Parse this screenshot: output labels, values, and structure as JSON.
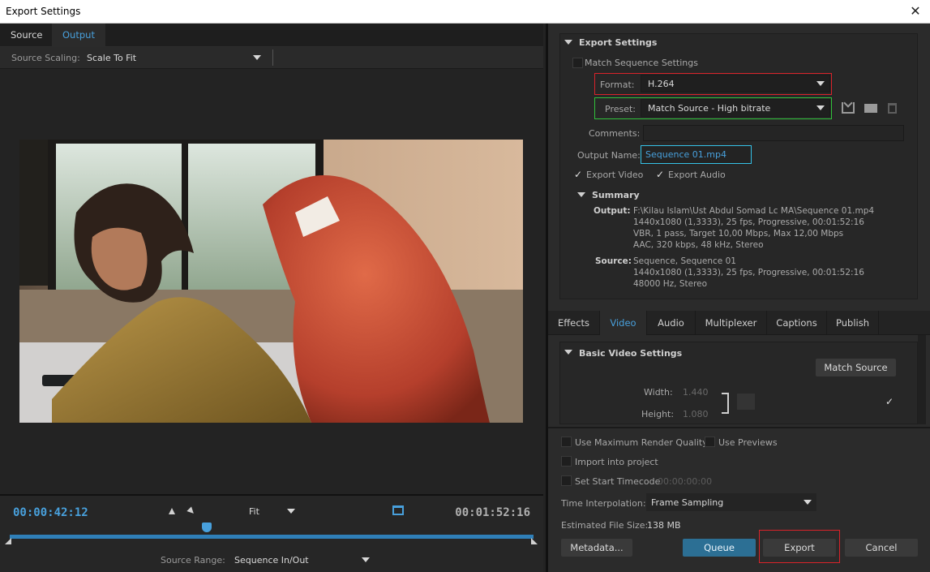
{
  "window": {
    "title": "Export Settings",
    "close_glyph": "✕"
  },
  "left": {
    "tabs": [
      {
        "label": "Source"
      },
      {
        "label": "Output"
      }
    ],
    "source_scaling": {
      "label": "Source Scaling:",
      "value": "Scale To Fit"
    },
    "timeline": {
      "current_time": "00:00:42:12",
      "duration": "00:01:52:16",
      "zoom": "Fit",
      "playhead_fraction": 0.376,
      "source_range": {
        "label": "Source Range:",
        "value": "Sequence In/Out"
      }
    }
  },
  "export_settings": {
    "header": "Export Settings",
    "match_sequence": {
      "label": "Match Sequence Settings",
      "checked": false
    },
    "format": {
      "label": "Format:",
      "value": "H.264"
    },
    "preset": {
      "label": "Preset:",
      "value": "Match Source - High bitrate"
    },
    "comments": {
      "label": "Comments:",
      "value": ""
    },
    "output_name": {
      "label": "Output Name:",
      "value": "Sequence 01.mp4"
    },
    "export_video": {
      "label": "Export Video",
      "checked": true
    },
    "export_audio": {
      "label": "Export Audio",
      "checked": true
    },
    "summary": {
      "header": "Summary",
      "output_label": "Output:",
      "output_lines": [
        "F:\\Kilau Islam\\Ust Abdul Somad Lc MA\\Sequence 01.mp4",
        "1440x1080 (1,3333), 25 fps, Progressive, 00:01:52:16",
        "VBR, 1 pass, Target 10,00 Mbps, Max 12,00 Mbps",
        "AAC, 320 kbps, 48 kHz, Stereo"
      ],
      "source_label": "Source:",
      "source_lines": [
        "Sequence, Sequence 01",
        "1440x1080 (1,3333), 25 fps, Progressive, 00:01:52:16",
        "48000 Hz, Stereo"
      ]
    }
  },
  "settings_tabs": [
    {
      "label": "Effects"
    },
    {
      "label": "Video"
    },
    {
      "label": "Audio"
    },
    {
      "label": "Multiplexer"
    },
    {
      "label": "Captions"
    },
    {
      "label": "Publish"
    }
  ],
  "basic_video": {
    "header": "Basic Video Settings",
    "match_source_button": "Match Source",
    "width": {
      "label": "Width:",
      "value": "1.440"
    },
    "height": {
      "label": "Height:",
      "value": "1.080"
    }
  },
  "bottom_options": {
    "max_render_quality": {
      "label": "Use Maximum Render Quality",
      "checked": false
    },
    "use_previews": {
      "label": "Use Previews",
      "checked": false
    },
    "import_into_project": {
      "label": "Import into project",
      "checked": false
    },
    "set_start_timecode": {
      "label": "Set Start Timecode",
      "checked": false,
      "value": "00:00:00:00"
    },
    "time_interpolation": {
      "label": "Time Interpolation:",
      "value": "Frame Sampling"
    },
    "estimated_size": {
      "label": "Estimated File Size:",
      "value": "138 MB"
    }
  },
  "buttons": {
    "metadata": "Metadata...",
    "queue": "Queue",
    "export": "Export",
    "cancel": "Cancel"
  },
  "colors": {
    "accent_blue": "#48a0dc",
    "highlight_red": "#d9232a",
    "highlight_green": "#31c23b",
    "highlight_cyan": "#35c2e8"
  }
}
